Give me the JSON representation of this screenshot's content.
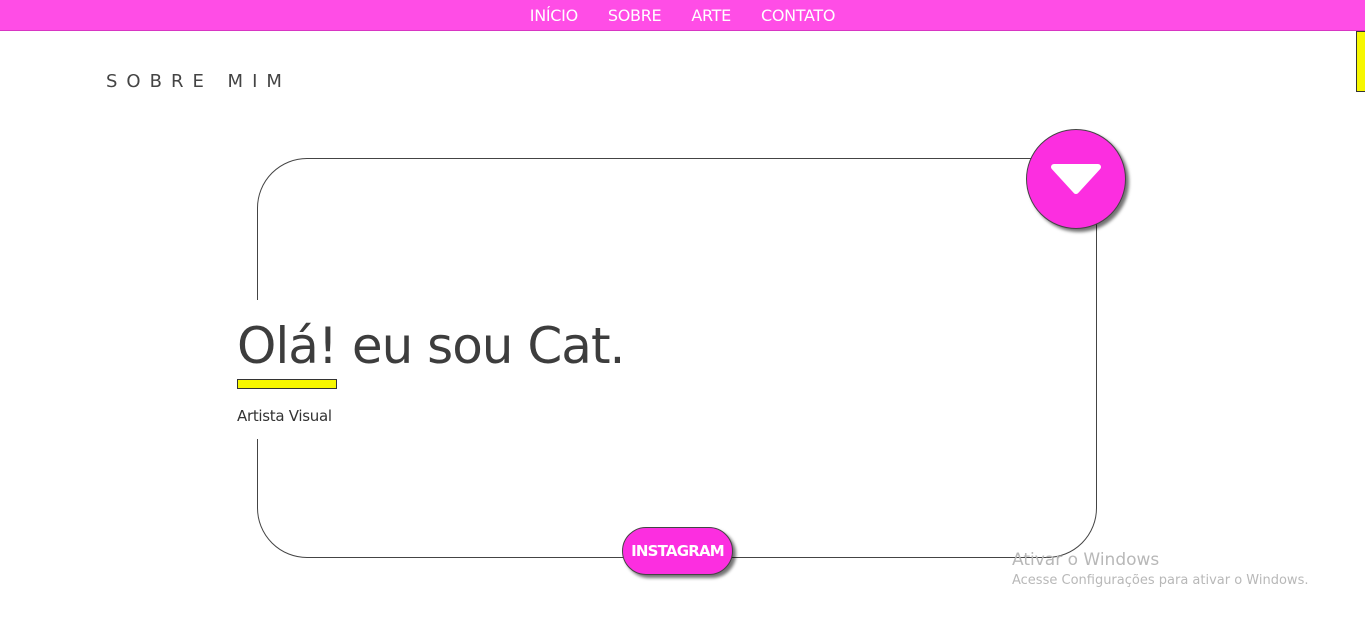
{
  "nav": {
    "items": [
      {
        "label": "INÍCIO"
      },
      {
        "label": "SOBRE"
      },
      {
        "label": "ARTE"
      },
      {
        "label": "CONTATO"
      }
    ]
  },
  "section": {
    "heading": "SOBRE MIM"
  },
  "card": {
    "greeting": "Olá! eu sou Cat.",
    "subtitle": "Artista Visual",
    "toggle_icon": "chevron-down-icon",
    "instagram_label": "INSTAGRAM"
  },
  "watermark": {
    "title": "Ativar o Windows",
    "subtitle": "Acesse Configurações para ativar o Windows."
  },
  "colors": {
    "nav_bg": "#ff4de6",
    "accent_pink": "#fc2ee0",
    "accent_yellow": "#f7f700",
    "text_dark": "#3d3d3d"
  }
}
